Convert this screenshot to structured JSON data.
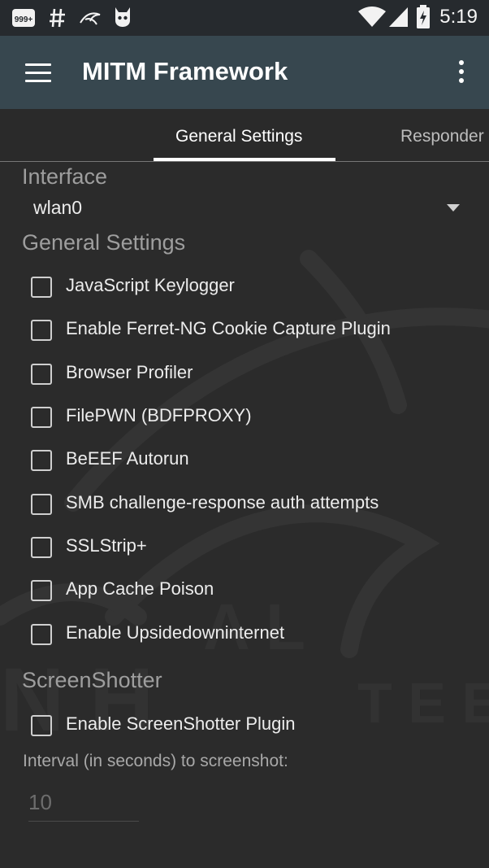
{
  "status_bar": {
    "time": "5:19",
    "icons": [
      "notifications-999-icon",
      "hashtag-icon",
      "kali-dragon-icon",
      "android-cat-icon",
      "wifi-icon",
      "signal-icon",
      "battery-charging-icon"
    ],
    "badge_text": "999+"
  },
  "appbar": {
    "title": "MITM Framework",
    "menu_icon": "hamburger-menu-icon",
    "overflow_icon": "more-vertical-icon",
    "background": "#37474f"
  },
  "tabs": [
    {
      "label": "General Settings",
      "selected": true
    },
    {
      "label": "Responder",
      "selected": false
    }
  ],
  "interface": {
    "label": "Interface",
    "selected": "wlan0"
  },
  "general": {
    "heading": "General Settings",
    "options": [
      {
        "label": "JavaScript Keylogger",
        "checked": false
      },
      {
        "label": "Enable Ferret-NG Cookie Capture Plugin",
        "checked": false
      },
      {
        "label": "Browser Profiler",
        "checked": false
      },
      {
        "label": "FilePWN (BDFPROXY)",
        "checked": false
      },
      {
        "label": "BeEEF Autorun",
        "checked": false
      },
      {
        "label": "SMB challenge-response auth attempts",
        "checked": false
      },
      {
        "label": "SSLStrip+",
        "checked": false
      },
      {
        "label": "App Cache Poison",
        "checked": false
      },
      {
        "label": "Enable Upsidedowninternet",
        "checked": false
      }
    ]
  },
  "screenshotter": {
    "heading": "ScreenShotter",
    "option": {
      "label": "Enable ScreenShotter Plugin",
      "checked": false
    },
    "interval_label": "Interval (in seconds) to screenshot:",
    "interval_value": "10"
  }
}
